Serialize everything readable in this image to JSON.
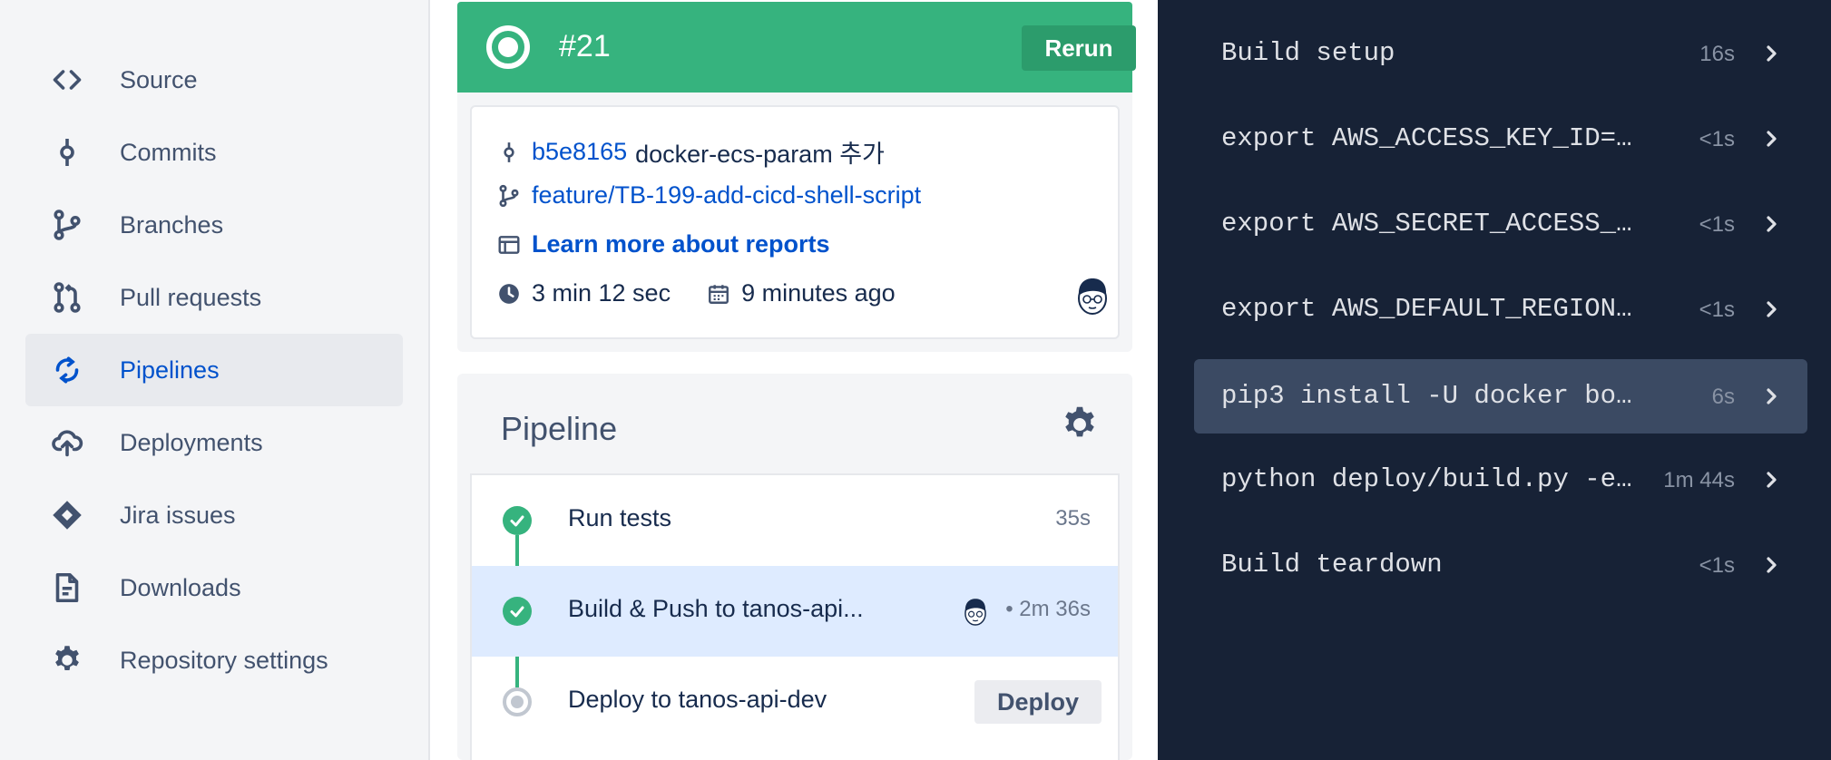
{
  "sidebar": {
    "items": [
      {
        "label": "Source",
        "icon": "code-icon"
      },
      {
        "label": "Commits",
        "icon": "commit-icon"
      },
      {
        "label": "Branches",
        "icon": "branch-icon"
      },
      {
        "label": "Pull requests",
        "icon": "pull-request-icon"
      },
      {
        "label": "Pipelines",
        "icon": "pipelines-icon",
        "active": true
      },
      {
        "label": "Deployments",
        "icon": "cloud-upload-icon"
      },
      {
        "label": "Jira issues",
        "icon": "jira-icon"
      },
      {
        "label": "Downloads",
        "icon": "document-icon"
      },
      {
        "label": "Repository settings",
        "icon": "gear-icon"
      }
    ]
  },
  "run": {
    "number": "#21",
    "rerun_label": "Rerun",
    "status_color": "#36b37e"
  },
  "summary": {
    "commit_hash": "b5e8165",
    "commit_message": "docker-ecs-param 추가",
    "branch": "feature/TB-199-add-cicd-shell-script",
    "reports_link": "Learn more about reports",
    "duration": "3 min 12 sec",
    "started": "9 minutes ago"
  },
  "pipeline": {
    "title": "Pipeline",
    "steps": [
      {
        "label": "Run tests",
        "time": "35s",
        "status": "success"
      },
      {
        "label": "Build & Push to tanos-api...",
        "time": "• 2m 36s",
        "status": "success"
      },
      {
        "label": "Deploy to tanos-api-dev",
        "status": "pending",
        "action": "Deploy"
      }
    ]
  },
  "log": {
    "rows": [
      {
        "cmd": "Build setup",
        "time": "16s"
      },
      {
        "cmd": "export AWS_ACCESS_KEY_ID=…",
        "time": "<1s"
      },
      {
        "cmd": "export AWS_SECRET_ACCESS_…",
        "time": "<1s"
      },
      {
        "cmd": "export AWS_DEFAULT_REGION…",
        "time": "<1s"
      },
      {
        "cmd": "pip3 install -U docker bo…",
        "time": "6s"
      },
      {
        "cmd": "python deploy/build.py -e…",
        "time": "1m 44s"
      },
      {
        "cmd": "Build teardown",
        "time": "<1s"
      }
    ]
  }
}
